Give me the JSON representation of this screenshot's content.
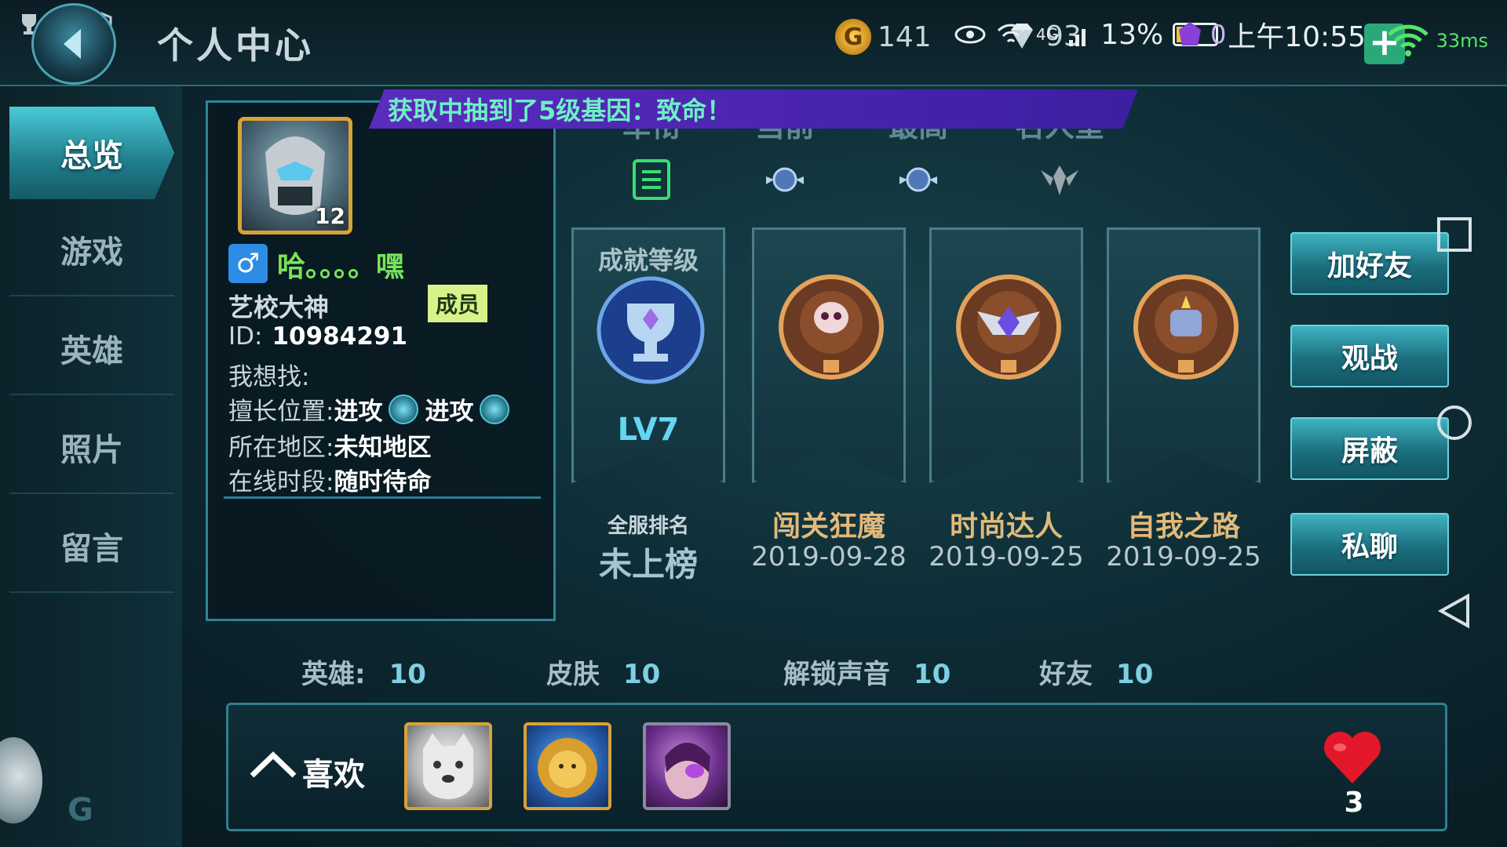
{
  "header": {
    "title": "个人中心",
    "gold": "141",
    "diamond": "93",
    "purple_gem": "0",
    "battery_percent": "13%",
    "time": "上午10:55",
    "network": "4G",
    "ping": "33ms"
  },
  "nav": {
    "items": [
      "总览",
      "游戏",
      "英雄",
      "照片",
      "留言"
    ],
    "active": "总览"
  },
  "profile": {
    "avatar_level": "12",
    "gender_symbol": "♂",
    "nickname": "哈。。。。嘿",
    "title": "艺校大神",
    "badge": "成员",
    "id_label": "ID:",
    "id_value": "10984291",
    "looking_for_label": "我想找:",
    "position_label": "擅长位置:",
    "position_1": "进攻",
    "position_2": "进攻",
    "region_label": "所在地区:",
    "region_value": "未知地区",
    "online_label": "在线时段:",
    "online_value": "随时待命"
  },
  "marquee": "获取中抽到了5级基因：致命！",
  "rank_tabs": [
    "军衔",
    "当前",
    "最高",
    "名人堂"
  ],
  "achievement_level": {
    "label": "成就等级",
    "level": "LV7",
    "rank_label": "全服排名",
    "rank_value": "未上榜"
  },
  "achievements": [
    {
      "name": "闯关狂魔",
      "date": "2019-09-28"
    },
    {
      "name": "时尚达人",
      "date": "2019-09-25"
    },
    {
      "name": "自我之路",
      "date": "2019-09-25"
    }
  ],
  "actions": [
    "加好友",
    "观战",
    "屏蔽",
    "私聊"
  ],
  "stats": {
    "heroes_label": "英雄:",
    "heroes": "10",
    "skins_label": "皮肤",
    "skins": "10",
    "voices_label": "解锁声音",
    "voices": "10",
    "friends_label": "好友",
    "friends": "10"
  },
  "likes": {
    "label": "喜欢",
    "count": "3"
  },
  "colors": {
    "accent": "#2f8496",
    "nickname": "#78e35a",
    "marquee_bg": "#5b2bbf",
    "marquee_text": "#6df0c4",
    "achievement_name": "#e1b97a",
    "level": "#63d6f2"
  }
}
